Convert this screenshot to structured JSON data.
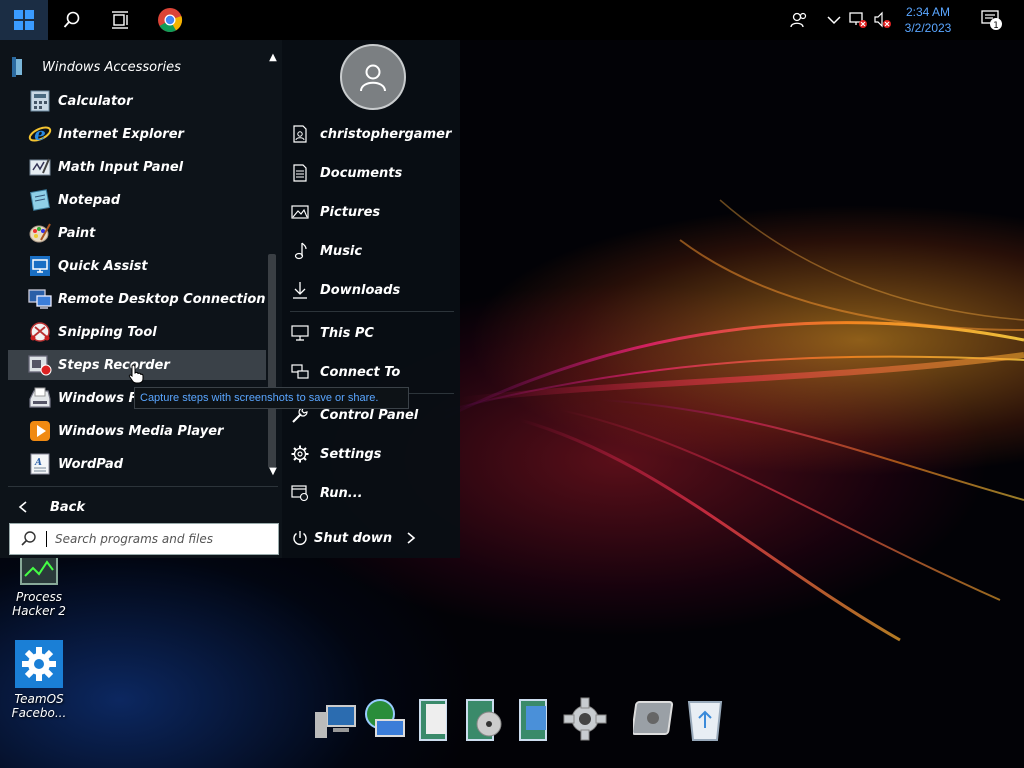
{
  "taskbar": {
    "clock_time": "2:34 AM",
    "clock_date": "3/2/2023",
    "notification_count": "1"
  },
  "start_menu": {
    "category": "Windows Accessories",
    "items": [
      {
        "label": "Calculator",
        "icon": "calculator-icon"
      },
      {
        "label": "Internet Explorer",
        "icon": "internet-explorer-icon"
      },
      {
        "label": "Math Input Panel",
        "icon": "math-input-icon"
      },
      {
        "label": "Notepad",
        "icon": "notepad-icon"
      },
      {
        "label": "Paint",
        "icon": "paint-icon"
      },
      {
        "label": "Quick Assist",
        "icon": "quick-assist-icon"
      },
      {
        "label": "Remote Desktop Connection",
        "icon": "remote-desktop-icon"
      },
      {
        "label": "Snipping Tool",
        "icon": "snipping-tool-icon"
      },
      {
        "label": "Steps Recorder",
        "icon": "steps-recorder-icon"
      },
      {
        "label": "Windows Fax",
        "icon": "fax-icon"
      },
      {
        "label": "Windows Media Player",
        "icon": "media-player-icon"
      },
      {
        "label": "WordPad",
        "icon": "wordpad-icon"
      }
    ],
    "back_label": "Back",
    "search_placeholder": "Search programs and files",
    "tooltip": "Capture steps with screenshots to save or share.",
    "right_items": [
      {
        "label": "christophergamer",
        "icon": "user-folder-icon"
      },
      {
        "label": "Documents",
        "icon": "document-icon"
      },
      {
        "label": "Pictures",
        "icon": "picture-icon"
      },
      {
        "label": "Music",
        "icon": "music-note-icon"
      },
      {
        "label": "Downloads",
        "icon": "download-icon"
      },
      {
        "label": "This PC",
        "icon": "monitor-icon"
      },
      {
        "label": "Connect To",
        "icon": "network-icon"
      },
      {
        "label": "Control Panel",
        "icon": "wrench-icon"
      },
      {
        "label": "Settings",
        "icon": "gear-icon"
      },
      {
        "label": "Run...",
        "icon": "run-icon"
      }
    ],
    "shutdown_label": "Shut down"
  },
  "desktop": {
    "icons": [
      {
        "label": "Process Hacker 2",
        "icon": "process-hacker-icon"
      },
      {
        "label": "TeamOS Facebo...",
        "icon": "gear-settings-icon"
      }
    ]
  },
  "colors": {
    "accent_blue": "#5aa6ff",
    "menu_bg": "#0e141a",
    "highlight": "#3a4148"
  }
}
